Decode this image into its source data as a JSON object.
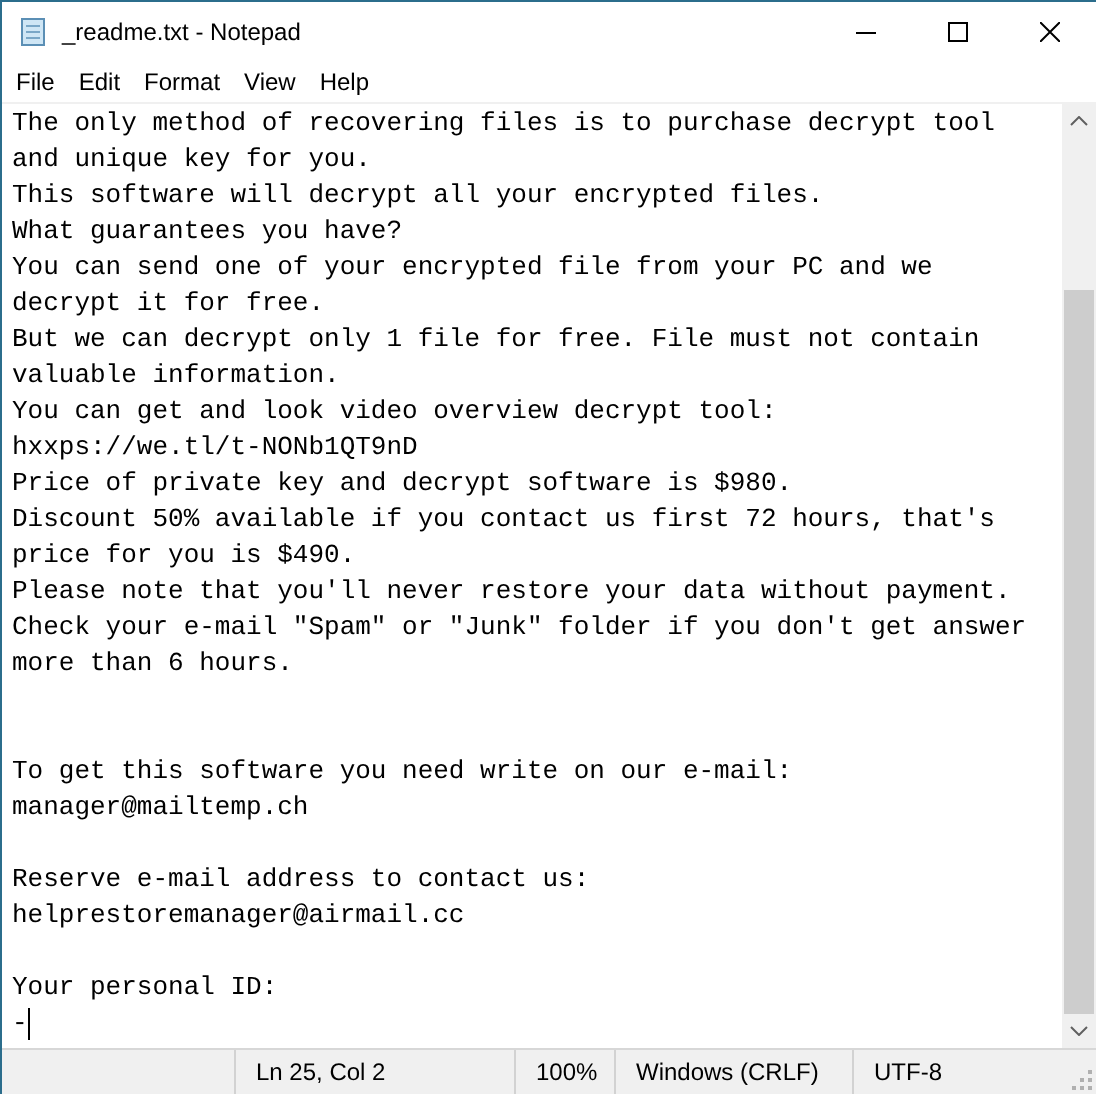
{
  "window": {
    "title": "_readme.txt - Notepad"
  },
  "menu": [
    "File",
    "Edit",
    "Format",
    "View",
    "Help"
  ],
  "document": {
    "paragraphs": [
      {
        "lines": [
          "The only method of recovering files is to purchase decrypt tool",
          "and unique key for you.",
          "This software will decrypt all your encrypted files.",
          "What guarantees you have?",
          "You can send one of your encrypted file from your PC and we",
          "decrypt it for free.",
          "But we can decrypt only 1 file for free. File must not contain",
          "valuable information.",
          "You can get and look video overview decrypt tool:",
          "hxxps://we.tl/t-NONb1QT9nD",
          "Price of private key and decrypt software is $980.",
          "Discount 50% available if you contact us first 72 hours, that's",
          "price for you is $490.",
          "Please note that you'll never restore your data without payment.",
          "Check your e-mail \"Spam\" or \"Junk\" folder if you don't get answer",
          "more than 6 hours."
        ]
      },
      {
        "lines": [
          "To get this software you need write on our e-mail:",
          "manager@mailtemp.ch"
        ]
      },
      {
        "lines": [
          "Reserve e-mail address to contact us:",
          "helprestoremanager@airmail.cc"
        ]
      },
      {
        "lines": [
          "Your personal ID:",
          "-"
        ]
      }
    ]
  },
  "status_bar": [
    "Ln 25, Col 2",
    "100%",
    "Windows (CRLF)",
    "UTF-8"
  ]
}
